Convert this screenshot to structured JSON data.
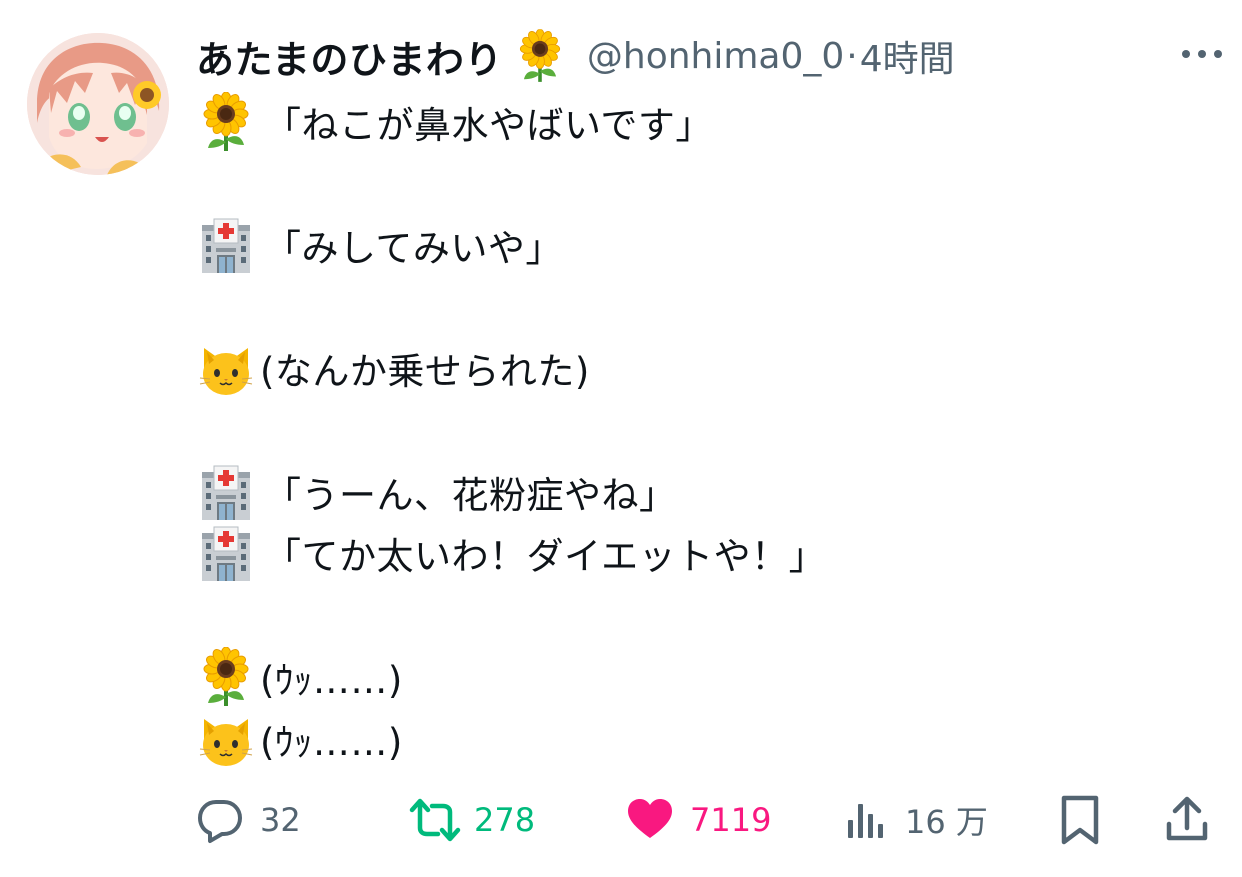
{
  "user": {
    "display_name": "あたまのひまわり",
    "name_emoji_icon": "sunflower-icon",
    "handle": "@honhima0_0",
    "separator": "·",
    "time": "4時間"
  },
  "tweet": {
    "lines": [
      {
        "icon": "sunflower-icon",
        "text": "「ねこが鼻水やばいです」"
      },
      {
        "icon": "hospital-icon",
        "text": "「みしてみいや」"
      },
      {
        "icon": "cat-face-icon",
        "text": "(なんか乗せられた)"
      },
      {
        "icon": "hospital-icon",
        "text": "「うーん、花粉症やね」"
      },
      {
        "icon": "hospital-icon",
        "text": "「てか太いわ！ダイエットや！」"
      },
      {
        "icon": "sunflower-icon",
        "text": "(ｳｯ……)"
      },
      {
        "icon": "cat-face-icon",
        "text": "(ｳｯ……)"
      }
    ]
  },
  "actions": {
    "reply": {
      "icon": "reply-icon",
      "count": "32",
      "color": "#536471"
    },
    "retweet": {
      "icon": "retweet-icon",
      "count": "278",
      "color": "#00ba7c"
    },
    "like": {
      "icon": "heart-icon",
      "count": "7119",
      "color": "#f91880"
    },
    "views": {
      "icon": "views-icon",
      "count": "16 万",
      "color": "#536471"
    },
    "bookmark": {
      "icon": "bookmark-icon"
    },
    "share": {
      "icon": "share-icon"
    }
  },
  "colors": {
    "text_primary": "#0f1419",
    "text_secondary": "#536471",
    "retweet_green": "#00ba7c",
    "like_pink": "#f91880"
  }
}
